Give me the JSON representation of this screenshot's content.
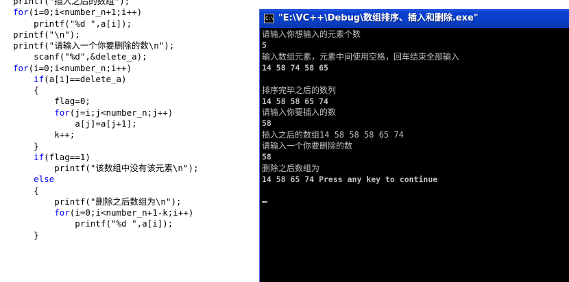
{
  "code_editor": {
    "lines": [
      {
        "pre": "printf(\"插入之后的数组\");",
        "kw": "",
        "post": ""
      },
      {
        "pre": "",
        "kw": "for",
        "post": "(i=0;i<number_n+1;i++)"
      },
      {
        "pre": "    printf(\"%d \",a[i]);",
        "kw": "",
        "post": ""
      },
      {
        "pre": "printf(\"\\n\");",
        "kw": "",
        "post": ""
      },
      {
        "pre": "printf(\"请输入一个你要删除的数\\n\");",
        "kw": "",
        "post": ""
      },
      {
        "pre": "    scanf(\"%d\",&delete_a);",
        "kw": "",
        "post": ""
      },
      {
        "pre": "",
        "kw": "for",
        "post": "(i=0;i<number_n;i++)"
      },
      {
        "pre": "    ",
        "kw": "if",
        "post": "(a[i]==delete_a)"
      },
      {
        "pre": "    {",
        "kw": "",
        "post": ""
      },
      {
        "pre": "        flag=0;",
        "kw": "",
        "post": ""
      },
      {
        "pre": "        ",
        "kw": "for",
        "post": "(j=i;j<number_n;j++)"
      },
      {
        "pre": "            a[j]=a[j+1];",
        "kw": "",
        "post": ""
      },
      {
        "pre": "        k++;",
        "kw": "",
        "post": ""
      },
      {
        "pre": "    }",
        "kw": "",
        "post": ""
      },
      {
        "pre": "    ",
        "kw": "if",
        "post": "(flag==1)"
      },
      {
        "pre": "        printf(\"该数组中没有该元素\\n\");",
        "kw": "",
        "post": ""
      },
      {
        "pre": "    ",
        "kw": "else",
        "post": ""
      },
      {
        "pre": "    {",
        "kw": "",
        "post": ""
      },
      {
        "pre": "        printf(\"删除之后数组为\\n\");",
        "kw": "",
        "post": ""
      },
      {
        "pre": "        ",
        "kw": "for",
        "post": "(i=0;i<number_n+1-k;i++)"
      },
      {
        "pre": "            printf(\"%d \",a[i]);",
        "kw": "",
        "post": ""
      },
      {
        "pre": "    }",
        "kw": "",
        "post": ""
      }
    ]
  },
  "console_window": {
    "title": "\"E:\\VC++\\Debug\\数组排序、插入和删除.exe\"",
    "icon_text": "C:\\",
    "output_lines": [
      {
        "text": "请输入你想输入的元素个数",
        "num": false
      },
      {
        "text": "5",
        "num": true
      },
      {
        "text": "输入数组元素，元素中间使用空格，回车结束全部输入",
        "num": false
      },
      {
        "text": "14 58 74 58 65",
        "num": true
      },
      {
        "text": "",
        "num": false
      },
      {
        "text": "排序完毕之后的数列",
        "num": false
      },
      {
        "text": "14 58 58 65 74",
        "num": true
      },
      {
        "text": "请输入你要插入的数",
        "num": false
      },
      {
        "text": "58",
        "num": true
      },
      {
        "text": "插入之后的数组14 58 58 58 65 74",
        "num": false
      },
      {
        "text": "请输入一个你要删除的数",
        "num": false
      },
      {
        "text": "58",
        "num": true
      },
      {
        "text": "删除之后数组为",
        "num": false
      },
      {
        "text": "14 58 65 74 Press any key to continue",
        "num": true
      }
    ]
  },
  "colors": {
    "keyword": "#0000ff",
    "code_text": "#000000",
    "console_text": "#c0c0c0",
    "console_bg": "#000000",
    "titlebar": "#0840c8"
  }
}
